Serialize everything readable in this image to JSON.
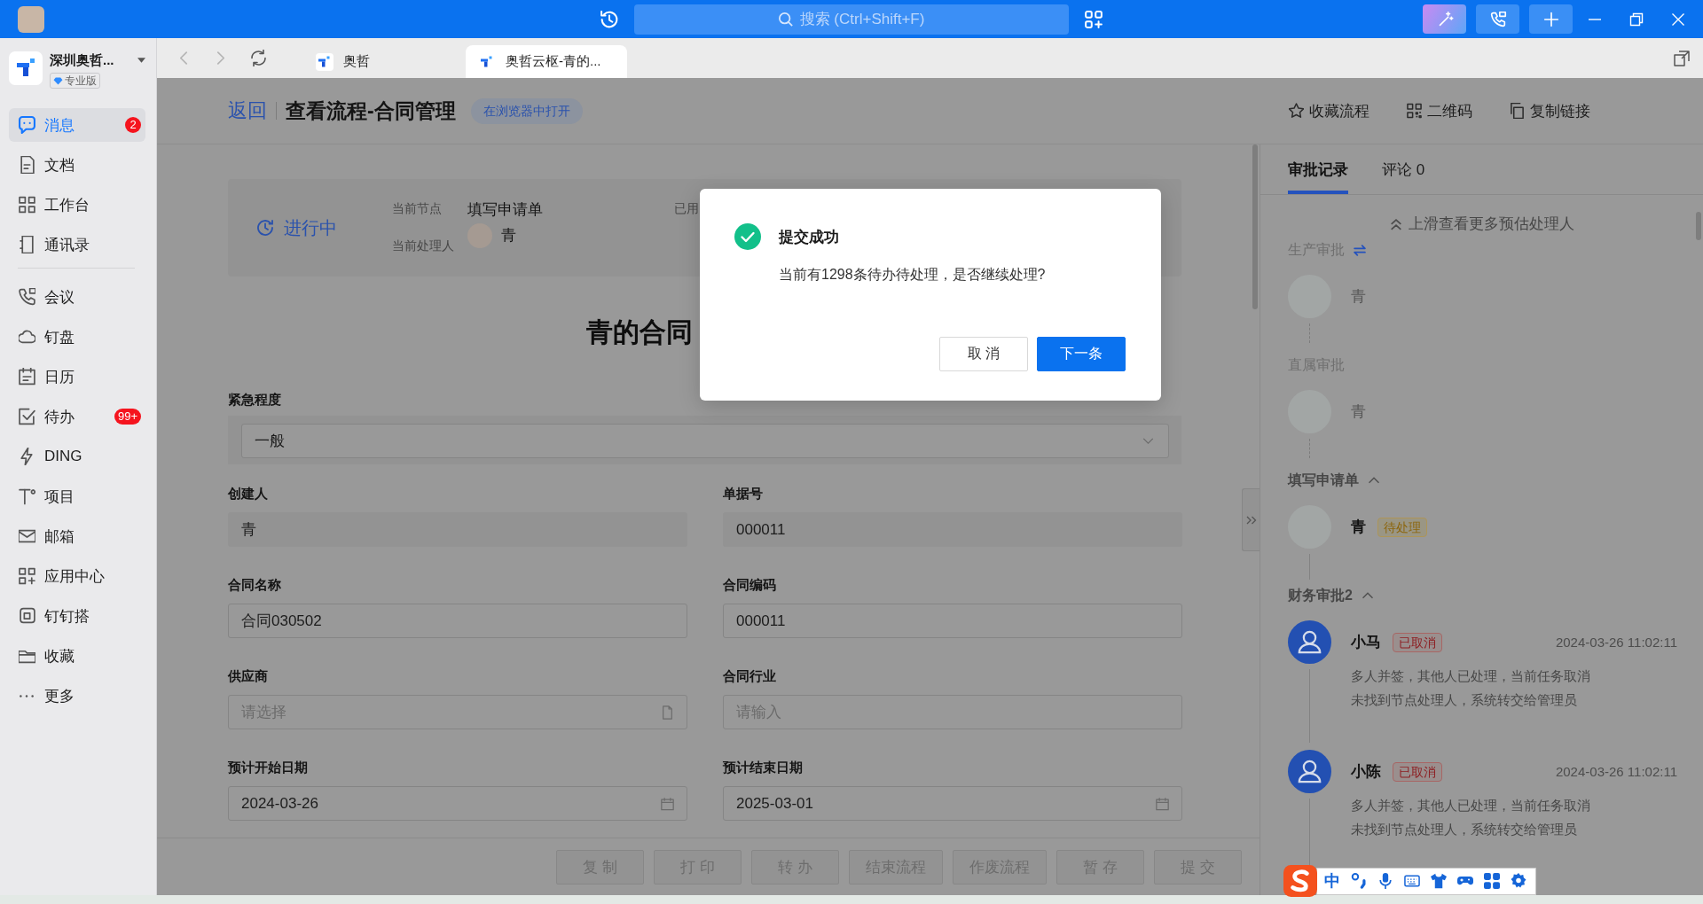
{
  "title_bar": {
    "search": {
      "placeholder": "搜索 (Ctrl+Shift+F)"
    }
  },
  "sidebar": {
    "org": {
      "name": "深圳奥哲...",
      "edition": "专业版"
    },
    "groups": [
      {
        "items": [
          {
            "label": "消息",
            "badge": "2",
            "selected": true
          },
          {
            "label": "文档",
            "selected": false
          },
          {
            "label": "工作台",
            "selected": false
          },
          {
            "label": "通讯录",
            "selected": false
          }
        ]
      },
      {
        "items": [
          {
            "label": "会议",
            "selected": false
          },
          {
            "label": "钉盘",
            "selected": false
          },
          {
            "label": "日历",
            "selected": false
          },
          {
            "label": "待办",
            "badge": "99+",
            "selected": false
          },
          {
            "label": "DING",
            "selected": false
          },
          {
            "label": "项目",
            "selected": false
          },
          {
            "label": "邮箱",
            "selected": false
          },
          {
            "label": "应用中心",
            "selected": false
          },
          {
            "label": "钉钉搭",
            "selected": false
          },
          {
            "label": "收藏",
            "selected": false
          },
          {
            "label": "更多",
            "selected": false
          }
        ]
      }
    ]
  },
  "tabs": [
    {
      "label": "奥哲",
      "selected": false
    },
    {
      "label": "奥哲云枢-青的...",
      "selected": true
    }
  ],
  "page_header": {
    "back": "返回",
    "title": "查看流程-合同管理",
    "open_in_browser": "在浏览器中打开",
    "actions": [
      "收藏流程",
      "二维码",
      "复制链接"
    ]
  },
  "status_card": {
    "status": "进行中",
    "fields": [
      {
        "label": "当前节点",
        "value": "填写申请单",
        "kind": "text"
      },
      {
        "label": "当前处理人",
        "value": "青",
        "kind": "person"
      }
    ],
    "elapsed_label": "已用"
  },
  "form": {
    "title": "青的合同",
    "urgency": {
      "label": "紧急程度",
      "value": "一般"
    },
    "fields": [
      {
        "label": "创建人",
        "value": "青",
        "kind": "readonly"
      },
      {
        "label": "单据号",
        "value": "000011",
        "kind": "readonly"
      },
      {
        "label": "合同名称",
        "value": "合同030502",
        "kind": "text"
      },
      {
        "label": "合同编码",
        "value": "000011",
        "kind": "text"
      },
      {
        "label": "供应商",
        "placeholder": "请选择",
        "kind": "picker"
      },
      {
        "label": "合同行业",
        "placeholder": "请输入",
        "kind": "text"
      },
      {
        "label": "预计开始日期",
        "value": "2024-03-26",
        "kind": "date"
      },
      {
        "label": "预计结束日期",
        "value": "2025-03-01",
        "kind": "date"
      }
    ]
  },
  "actions": [
    {
      "label": "复 制",
      "disabled": true
    },
    {
      "label": "打 印",
      "disabled": true
    },
    {
      "label": "转 办",
      "disabled": true
    },
    {
      "label": "结束流程",
      "disabled": true
    },
    {
      "label": "作废流程",
      "disabled": true
    },
    {
      "label": "暂 存",
      "disabled": true
    },
    {
      "label": "提 交",
      "disabled": true
    }
  ],
  "approval_panel": {
    "tabs": [
      {
        "label": "审批记录",
        "selected": true
      },
      {
        "label": "评论 0",
        "selected": false
      }
    ],
    "scroll_hint": "上滑查看更多预估处理人",
    "nodes": [
      {
        "title": "生产审批",
        "kind": "estimated",
        "switch": true,
        "people": [
          {
            "name": "青",
            "kind": "photo"
          }
        ]
      },
      {
        "title": "直属审批",
        "kind": "estimated",
        "switch": false,
        "people": [
          {
            "name": "青",
            "kind": "photo"
          }
        ]
      },
      {
        "title": "填写申请单",
        "kind": "actual",
        "expanded": true,
        "switch": false,
        "people": [
          {
            "name": "青",
            "kind": "photo",
            "status": {
              "label": "待处理",
              "kind": "pending"
            }
          }
        ]
      },
      {
        "title": "财务审批2",
        "kind": "actual",
        "expanded": true,
        "switch": false,
        "people": [
          {
            "name": "小马",
            "kind": "default",
            "status": {
              "label": "已取消",
              "kind": "cancelled"
            },
            "time": "2024-03-26 11:02:11",
            "notes": [
              "多人并签，其他人已处理，当前任务取消",
              "未找到节点处理人，系统转交给管理员"
            ]
          },
          {
            "name": "小陈",
            "kind": "default",
            "status": {
              "label": "已取消",
              "kind": "cancelled"
            },
            "time": "2024-03-26 11:02:11",
            "notes": [
              "多人并签，其他人已处理，当前任务取消",
              "未找到节点处理人，系统转交给管理员"
            ]
          }
        ]
      }
    ]
  },
  "dialog": {
    "title": "提交成功",
    "message": "当前有1298条待办待处理，是否继续处理?",
    "buttons": [
      {
        "label": "取 消",
        "kind": "default"
      },
      {
        "label": "下一条",
        "kind": "primary"
      }
    ]
  },
  "ime_toolbar": {
    "mode": "中"
  }
}
